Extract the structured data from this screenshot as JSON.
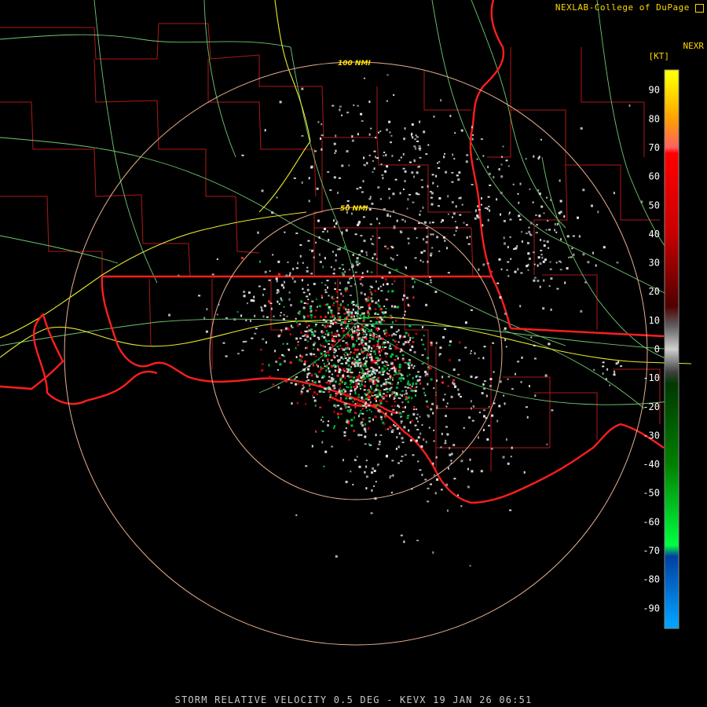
{
  "credit": "NEXLAB-College of DuPage",
  "credit_logo": "cod-logo-icon",
  "product_code": "NEXR",
  "unit": "[KT]",
  "caption": "STORM RELATIVE VELOCITY 0.5 DEG - KEVX 19 JAN 26 06:51",
  "range_rings": [
    {
      "label": "50 NMI",
      "range_nmi": 50
    },
    {
      "label": "100 NMI",
      "range_nmi": 100
    }
  ],
  "colorbar": {
    "ticks": [
      "90",
      "80",
      "70",
      "60",
      "50",
      "40",
      "30",
      "20",
      "10",
      "0",
      "-10",
      "-20",
      "-30",
      "-40",
      "-50",
      "-60",
      "-70",
      "-80",
      "-90"
    ],
    "stops": [
      {
        "value": 95,
        "color": "#ffff00"
      },
      {
        "value": 80,
        "color": "#ffa000"
      },
      {
        "value": 70,
        "color": "#ff6060"
      },
      {
        "value": 68,
        "color": "#ff0000"
      },
      {
        "value": 40,
        "color": "#c80000"
      },
      {
        "value": 15,
        "color": "#500000"
      },
      {
        "value": 8,
        "color": "#606060"
      },
      {
        "value": 0,
        "color": "#d0d0d0"
      },
      {
        "value": -8,
        "color": "#404040"
      },
      {
        "value": -12,
        "color": "#003800"
      },
      {
        "value": -40,
        "color": "#008000"
      },
      {
        "value": -68,
        "color": "#00ff40"
      },
      {
        "value": -72,
        "color": "#0040a0"
      },
      {
        "value": -95,
        "color": "#00a0ff"
      }
    ]
  },
  "colors": {
    "state_border": "#ff1e1e",
    "county_line": "#b01818",
    "highway": "#e8e830",
    "road": "#70c870",
    "range_ring": "#e8b090"
  }
}
